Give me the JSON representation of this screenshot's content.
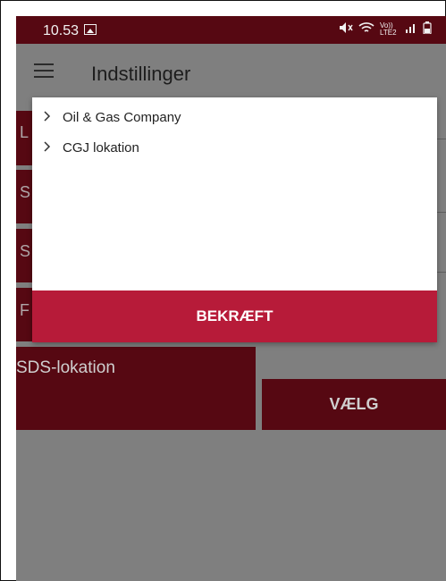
{
  "status_bar": {
    "time": "10.53",
    "network": "Vo)) LTE2"
  },
  "app_bar": {
    "title": "Indstillinger"
  },
  "background": {
    "row_letters": [
      "L",
      "S",
      "S",
      "F"
    ],
    "section_label": "SDS-lokation",
    "select_button": "VÆLG"
  },
  "dialog": {
    "items": [
      {
        "label": "Oil & Gas Company"
      },
      {
        "label": "CGJ lokation"
      }
    ],
    "confirm_label": "BEKRÆFT"
  },
  "colors": {
    "primary": "#560812",
    "accent": "#B71B39",
    "scrim": "#7F7F7F"
  }
}
